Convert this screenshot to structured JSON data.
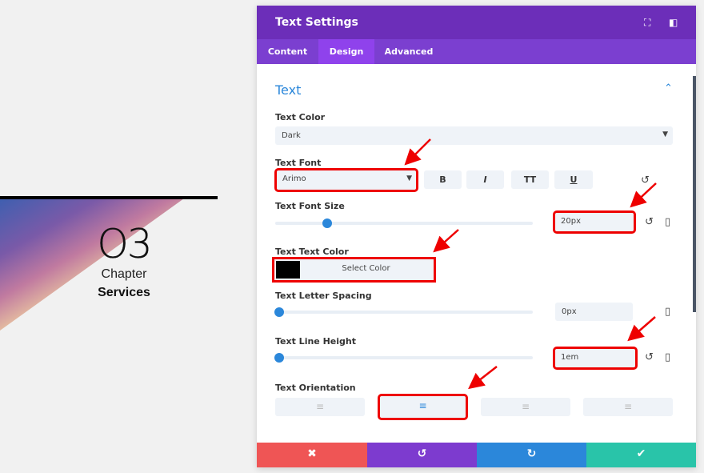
{
  "preview": {
    "number": "O3",
    "line1": "Chapter",
    "line2": "Services"
  },
  "modal": {
    "title": "Text Settings",
    "header_icons": [
      "fullscreen-icon",
      "sidebar-toggle-icon"
    ],
    "tabs": [
      {
        "label": "Content"
      },
      {
        "label": "Design",
        "active": true
      },
      {
        "label": "Advanced"
      }
    ],
    "section_title": "Text",
    "text_color": {
      "label": "Text Color",
      "value": "Dark"
    },
    "text_font": {
      "label": "Text Font",
      "value": "Arimo",
      "styles": [
        "B",
        "I",
        "TT",
        "U"
      ]
    },
    "font_size": {
      "label": "Text Font Size",
      "value": "20px",
      "slider_fraction": 0.2
    },
    "text_text_color": {
      "label": "Text Text Color",
      "button": "Select Color",
      "swatch": "#000000"
    },
    "letter_spacing": {
      "label": "Text Letter Spacing",
      "value": "0px",
      "slider_fraction": 0
    },
    "line_height": {
      "label": "Text Line Height",
      "value": "1em",
      "slider_fraction": 0
    },
    "orientation": {
      "label": "Text Orientation",
      "options": [
        "left",
        "center",
        "right",
        "justify"
      ],
      "selected": "center"
    },
    "footer": {
      "cancel": "✖",
      "undo": "↺",
      "redo": "↻",
      "save": "✔"
    }
  },
  "colors": {
    "header": "#6c2eb9",
    "accent": "#2b87da",
    "cancel": "#ef5555",
    "undo": "#7d3bcf",
    "redo": "#2b87da",
    "save": "#29c4a9",
    "annotation": "#e00000"
  }
}
